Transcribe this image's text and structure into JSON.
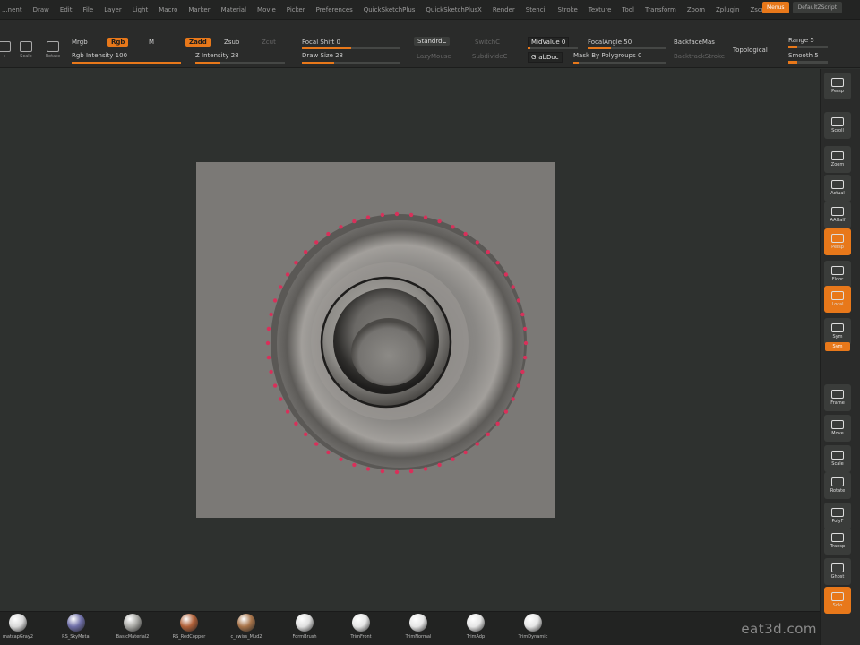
{
  "menu": {
    "items": [
      "...nent",
      "Draw",
      "Edit",
      "File",
      "Layer",
      "Light",
      "Macro",
      "Marker",
      "Material",
      "Movie",
      "Picker",
      "Preferences",
      "QuickSketchPlus",
      "QuickSketchPlusX",
      "Render",
      "Stencil",
      "Stroke",
      "Texture",
      "Tool",
      "Transform",
      "Zoom",
      "Zplugin",
      "Zscript"
    ],
    "right_btn1": "Menus",
    "right_btn2": "DefaultZScript"
  },
  "toolbar": {
    "tools": [
      {
        "label": "t",
        "icon": "edit-icon"
      },
      {
        "label": "Scale",
        "icon": "scale-icon"
      },
      {
        "label": "Rotate",
        "icon": "rotate-icon"
      }
    ],
    "mrgb": "Mrgb",
    "rgb": "Rgb",
    "m": "M",
    "zadd": "Zadd",
    "zsub": "Zsub",
    "zcut": "Zcut",
    "rgb_intensity": "Rgb Intensity 100",
    "z_intensity": "Z Intensity 28",
    "focal_shift": "Focal Shift 0",
    "draw_size": "Draw Size 28",
    "standard_btn": "StandrdC",
    "lazymouse": "LazyMouse",
    "switch": "SwitchC",
    "subdivide": "SubdivideC",
    "tpose": "TPoseC",
    "midvalue": "MidValue 0",
    "focalangle": "FocalAngle 50",
    "grabdoc": "GrabDoc",
    "mask_polygroups": "Mask By Polygroups 0",
    "backfacemask": "BackfaceMas",
    "backtrackstroke": "BacktrackStroke",
    "topological": "Topological",
    "range": "Range 5",
    "smooth": "Smooth 5"
  },
  "shelf": {
    "items": [
      {
        "label": "Persp",
        "icon": "sphere-icon",
        "on": false
      },
      {
        "label": "Scroll",
        "icon": "scroll-icon",
        "on": false
      },
      {
        "label": "Zoom",
        "icon": "zoom-icon",
        "on": false
      },
      {
        "label": "Actual",
        "icon": "actual-icon",
        "on": false
      },
      {
        "label": "AAHalf",
        "icon": "aahalf-icon",
        "on": false
      },
      {
        "label": "Persp",
        "icon": "persp-icon",
        "on": true
      },
      {
        "label": "Floor",
        "icon": "floor-icon",
        "on": false
      },
      {
        "label": "Local",
        "icon": "local-icon",
        "on": true
      },
      {
        "label": "Sym",
        "icon": "symmetry-icon",
        "on": false
      },
      {
        "label": "Frame",
        "icon": "frame-icon",
        "on": false
      },
      {
        "label": "Move",
        "icon": "move-icon",
        "on": false
      },
      {
        "label": "Scale",
        "icon": "scale-icon",
        "on": false
      },
      {
        "label": "Rotate",
        "icon": "rotate-icon",
        "on": false
      },
      {
        "label": "PolyF",
        "icon": "polyframe-icon",
        "on": false
      },
      {
        "label": "Transp",
        "icon": "transparency-icon",
        "on": false
      },
      {
        "label": "Ghost",
        "icon": "ghost-icon",
        "on": false
      },
      {
        "label": "Solo",
        "icon": "solo-icon",
        "on": true
      }
    ],
    "xyz_tag": "Sym"
  },
  "materials": [
    {
      "label": "matcapGray2",
      "color": "#d9d9d9"
    },
    {
      "label": "RS_SkyMetal",
      "color": "#6f6fa8"
    },
    {
      "label": "BasicMaterial2",
      "color": "#a8a8a4"
    },
    {
      "label": "RS_RedCopper",
      "color": "#b06038"
    },
    {
      "label": "c_swiss_Mud2",
      "color": "#a8744a"
    },
    {
      "label": "FormBrush",
      "color": "#e0e0e0"
    },
    {
      "label": "TrimFront",
      "color": "#e6e6e6"
    },
    {
      "label": "TrimNormal",
      "color": "#e6e6e6"
    },
    {
      "label": "TrimAdp",
      "color": "#e6e6e6"
    },
    {
      "label": "TrimDynamic",
      "color": "#e6e6e6"
    }
  ],
  "watermark": "eat3d.com",
  "accent": "#e8781a",
  "mask_dot_color": "#d8305a",
  "mask_dot_count": 56
}
